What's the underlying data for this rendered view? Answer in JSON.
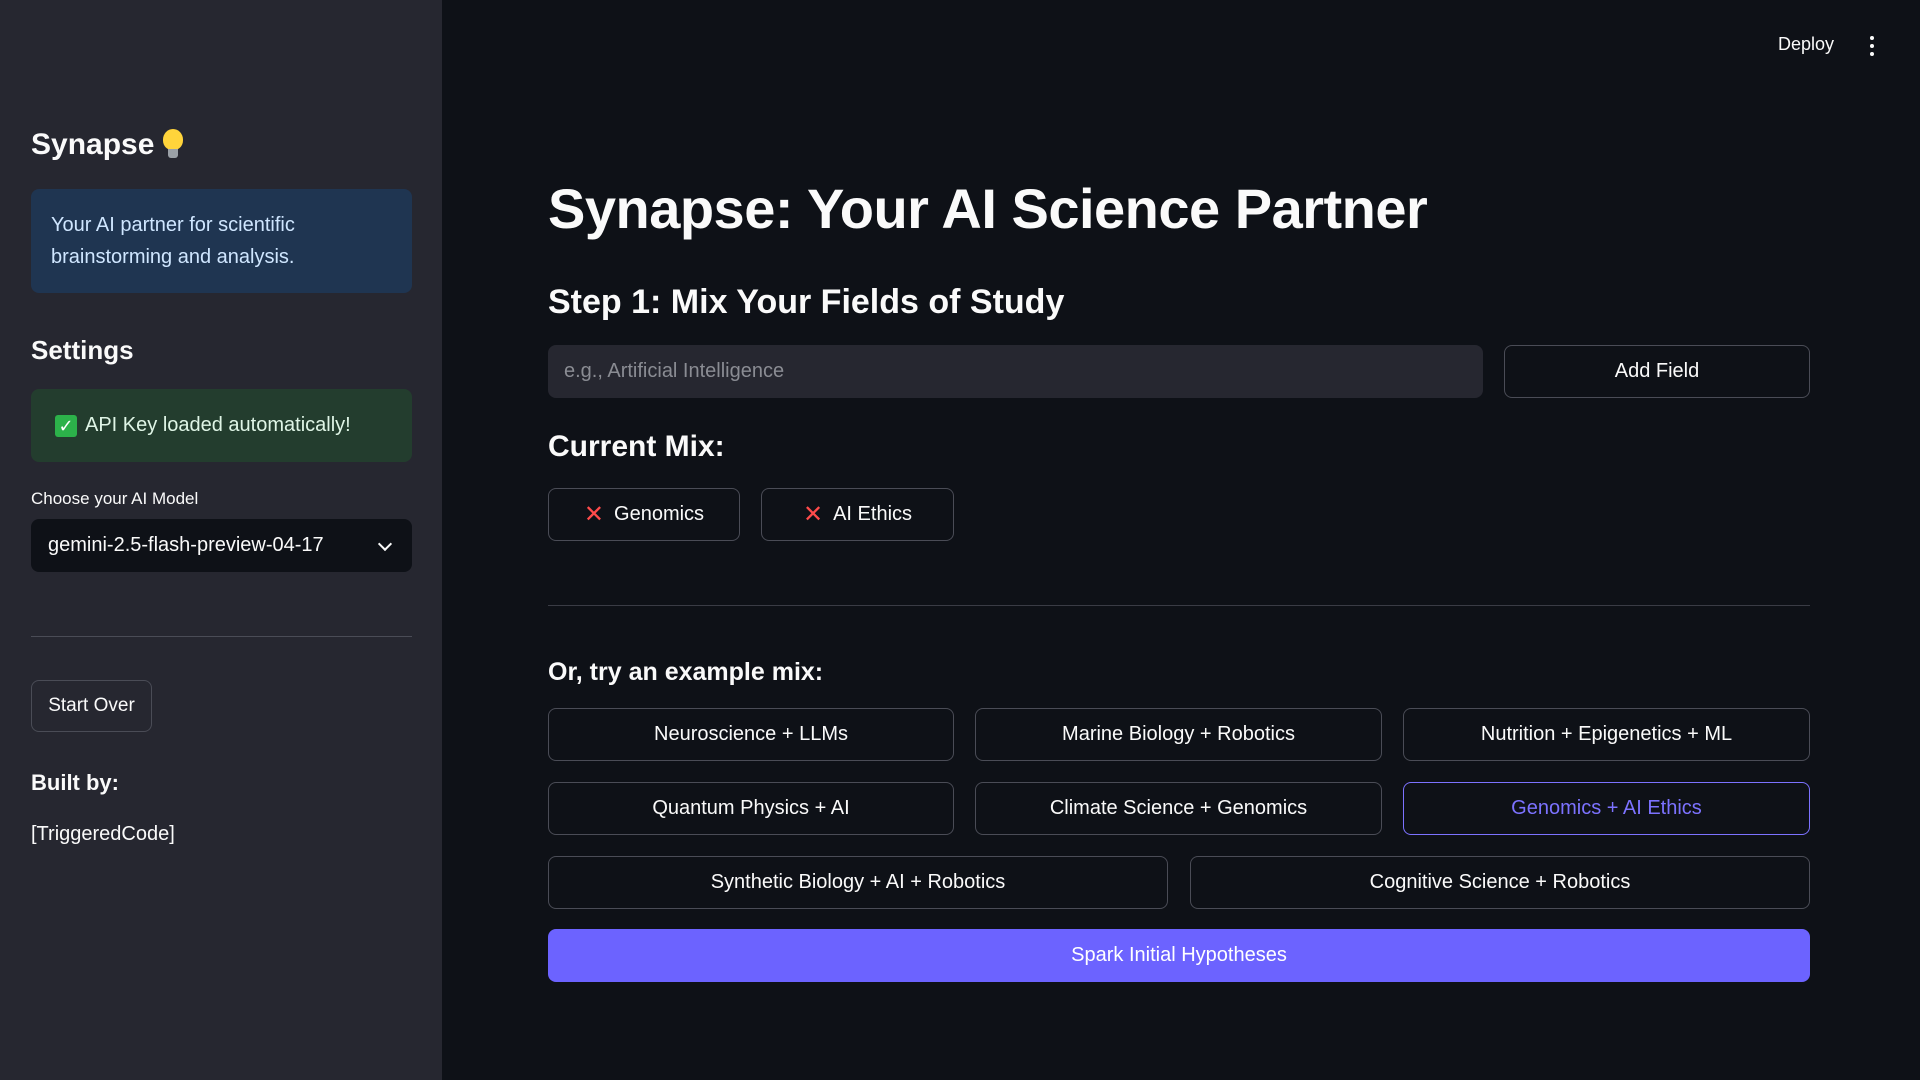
{
  "topbar": {
    "deploy_label": "Deploy",
    "menu_icon": "more-vertical-icon"
  },
  "sidebar": {
    "title": "Synapse",
    "title_icon": "lightbulb-icon",
    "info": "Your AI partner for scientific brainstorming and analysis.",
    "settings_heading": "Settings",
    "success_message": "API Key loaded automatically!",
    "success_icon": "check-box-icon",
    "model_label": "Choose your AI Model",
    "model_selected": "gemini-2.5-flash-preview-04-17",
    "start_over_label": "Start Over",
    "built_by_heading": "Built by:",
    "built_by_name": "[TriggeredCode]"
  },
  "main": {
    "title": "Synapse: Your AI Science Partner",
    "step1_heading": "Step 1: Mix Your Fields of Study",
    "field_input": {
      "value": "",
      "placeholder": "e.g., Artificial Intelligence"
    },
    "add_field_label": "Add Field",
    "current_mix_heading": "Current Mix:",
    "current_mix": [
      "Genomics",
      "AI Ethics"
    ],
    "example_heading": "Or, try an example mix:",
    "examples": [
      "Neuroscience + LLMs",
      "Marine Biology + Robotics",
      "Nutrition + Epigenetics + ML",
      "Quantum Physics + AI",
      "Climate Science + Genomics",
      "Genomics + AI Ethics",
      "Synthetic Biology + AI + Robotics",
      "Cognitive Science + Robotics"
    ],
    "active_example": "Genomics + AI Ethics",
    "spark_label": "Spark Initial Hypotheses"
  },
  "colors": {
    "background": "#0e1117",
    "sidebar": "#262730",
    "primary": "#6c63ff",
    "remove_icon": "#ff4b4b",
    "success": "#2cb24a"
  }
}
